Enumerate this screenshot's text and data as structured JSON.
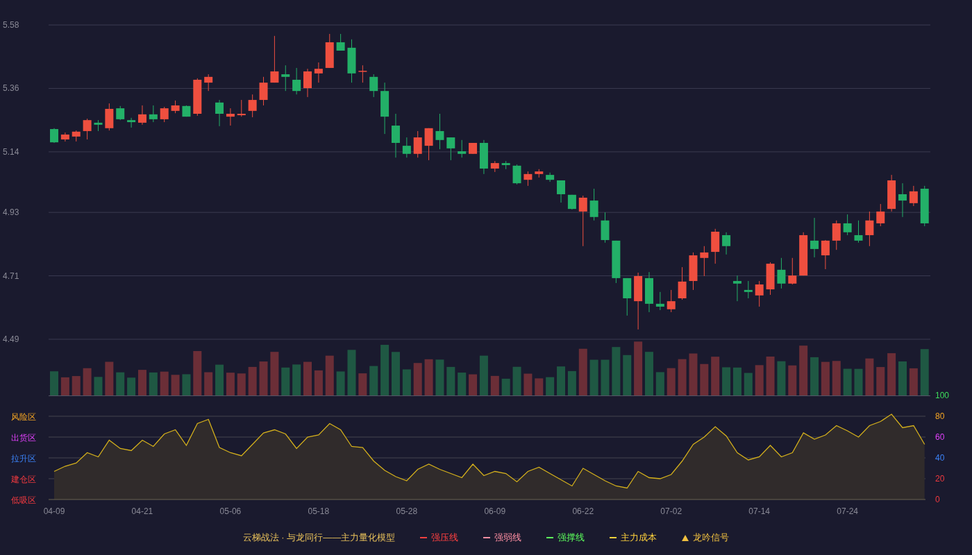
{
  "price_chart": {
    "chart_data": {
      "type": "candlestick",
      "grid": true,
      "ylim": [
        4.49,
        5.58
      ],
      "yticks": [
        {
          "value": 5.58,
          "label": "5.58"
        },
        {
          "value": 5.36,
          "label": "5.36"
        },
        {
          "value": 5.14,
          "label": "5.14"
        },
        {
          "value": 4.93,
          "label": "4.93"
        },
        {
          "value": 4.71,
          "label": "4.71"
        },
        {
          "value": 4.49,
          "label": "4.49"
        }
      ],
      "categories": [
        null,
        null,
        null,
        null,
        null,
        null,
        null,
        null,
        null,
        null,
        null,
        null,
        null,
        null,
        null,
        null,
        null,
        null,
        null,
        null,
        null,
        null,
        null,
        null,
        null,
        null,
        null,
        null,
        null,
        null,
        null,
        null,
        null,
        null,
        null,
        null,
        null,
        null,
        null,
        null,
        null,
        null,
        null,
        null,
        null,
        null,
        null,
        null,
        null,
        null,
        null,
        null,
        null,
        null,
        null,
        null,
        null,
        null,
        null,
        null,
        null,
        null,
        null,
        null,
        null,
        null,
        null,
        null,
        null,
        null,
        null,
        null,
        null,
        null,
        null,
        null,
        null,
        null,
        null,
        null
      ],
      "ohlc": [
        [
          5.219,
          5.222,
          5.171,
          5.173
        ],
        [
          5.183,
          5.207,
          5.176,
          5.2
        ],
        [
          5.193,
          5.214,
          5.176,
          5.21
        ],
        [
          5.212,
          5.255,
          5.183,
          5.25
        ],
        [
          5.241,
          5.25,
          5.212,
          5.234
        ],
        [
          5.222,
          5.308,
          5.214,
          5.289
        ],
        [
          5.291,
          5.299,
          5.25,
          5.253
        ],
        [
          5.25,
          5.258,
          5.224,
          5.243
        ],
        [
          5.241,
          5.301,
          5.234,
          5.27
        ],
        [
          5.27,
          5.301,
          5.243,
          5.253
        ],
        [
          5.253,
          5.296,
          5.243,
          5.291
        ],
        [
          5.282,
          5.318,
          5.274,
          5.301
        ],
        [
          5.299,
          5.301,
          5.262,
          5.262
        ],
        [
          5.272,
          5.395,
          5.265,
          5.39
        ],
        [
          5.38,
          5.409,
          5.351,
          5.4
        ],
        [
          5.311,
          5.32,
          5.229,
          5.272
        ],
        [
          5.262,
          5.291,
          5.231,
          5.272
        ],
        [
          5.267,
          5.32,
          5.262,
          5.272
        ],
        [
          5.282,
          5.339,
          5.26,
          5.32
        ],
        [
          5.32,
          5.4,
          5.301,
          5.38
        ],
        [
          5.38,
          5.542,
          5.38,
          5.419
        ],
        [
          5.409,
          5.44,
          5.351,
          5.4
        ],
        [
          5.39,
          5.431,
          5.339,
          5.351
        ],
        [
          5.361,
          5.428,
          5.33,
          5.419
        ],
        [
          5.412,
          5.45,
          5.38,
          5.428
        ],
        [
          5.431,
          5.549,
          5.431,
          5.52
        ],
        [
          5.52,
          5.549,
          5.491,
          5.491
        ],
        [
          5.501,
          5.53,
          5.38,
          5.412
        ],
        [
          5.419,
          5.44,
          5.38,
          5.421
        ],
        [
          5.4,
          5.409,
          5.33,
          5.351
        ],
        [
          5.351,
          5.38,
          5.202,
          5.262
        ],
        [
          5.231,
          5.272,
          5.12,
          5.171
        ],
        [
          5.161,
          5.19,
          5.12,
          5.133
        ],
        [
          5.133,
          5.212,
          5.12,
          5.19
        ],
        [
          5.161,
          5.222,
          5.111,
          5.222
        ],
        [
          5.212,
          5.272,
          5.149,
          5.181
        ],
        [
          5.19,
          5.19,
          5.111,
          5.152
        ],
        [
          5.142,
          5.181,
          5.12,
          5.133
        ],
        [
          5.133,
          5.171,
          5.133,
          5.171
        ],
        [
          5.171,
          5.181,
          5.063,
          5.082
        ],
        [
          5.082,
          5.108,
          5.07,
          5.101
        ],
        [
          5.101,
          5.108,
          5.08,
          5.094
        ],
        [
          5.092,
          5.096,
          5.027,
          5.031
        ],
        [
          5.043,
          5.072,
          5.022,
          5.063
        ],
        [
          5.063,
          5.08,
          5.051,
          5.072
        ],
        [
          5.06,
          5.068,
          5.036,
          5.043
        ],
        [
          5.041,
          5.041,
          4.964,
          4.993
        ],
        [
          4.991,
          4.991,
          4.94,
          4.942
        ],
        [
          4.933,
          4.988,
          4.813,
          4.981
        ],
        [
          4.971,
          5.012,
          4.902,
          4.914
        ],
        [
          4.902,
          4.93,
          4.825,
          4.834
        ],
        [
          4.832,
          4.832,
          4.685,
          4.702
        ],
        [
          4.702,
          4.702,
          4.572,
          4.632
        ],
        [
          4.622,
          4.721,
          4.524,
          4.709
        ],
        [
          4.702,
          4.723,
          4.584,
          4.613
        ],
        [
          4.613,
          4.654,
          4.591,
          4.603
        ],
        [
          4.594,
          4.661,
          4.584,
          4.622
        ],
        [
          4.632,
          4.74,
          4.627,
          4.69
        ],
        [
          4.692,
          4.791,
          4.661,
          4.781
        ],
        [
          4.772,
          4.813,
          4.709,
          4.791
        ],
        [
          4.793,
          4.873,
          4.752,
          4.863
        ],
        [
          4.851,
          4.861,
          4.784,
          4.813
        ],
        [
          4.692,
          4.711,
          4.622,
          4.683
        ],
        [
          4.661,
          4.692,
          4.632,
          4.654
        ],
        [
          4.642,
          4.692,
          4.603,
          4.68
        ],
        [
          4.663,
          4.757,
          4.644,
          4.752
        ],
        [
          4.731,
          4.772,
          4.666,
          4.683
        ],
        [
          4.683,
          4.772,
          4.68,
          4.711
        ],
        [
          4.711,
          4.861,
          4.711,
          4.851
        ],
        [
          4.832,
          4.911,
          4.774,
          4.803
        ],
        [
          4.781,
          4.834,
          4.733,
          4.832
        ],
        [
          4.832,
          4.902,
          4.8,
          4.892
        ],
        [
          4.892,
          4.923,
          4.851,
          4.861
        ],
        [
          4.851,
          4.902,
          4.825,
          4.832
        ],
        [
          4.851,
          4.933,
          4.813,
          4.902
        ],
        [
          4.892,
          4.959,
          4.882,
          4.933
        ],
        [
          4.942,
          5.06,
          4.933,
          5.041
        ],
        [
          4.993,
          5.031,
          4.914,
          4.971
        ],
        [
          4.962,
          5.022,
          4.952,
          5.003
        ],
        [
          5.012,
          5.022,
          4.882,
          4.892
        ]
      ]
    }
  },
  "indicator": {
    "bands": [
      {
        "tick": "100",
        "color": "#3ddc5b"
      },
      {
        "tick": "80",
        "zone": "风险区",
        "color": "#f5a623"
      },
      {
        "tick": "60",
        "zone": "出货区",
        "color": "#e040fb"
      },
      {
        "tick": "40",
        "zone": "拉升区",
        "color": "#3b82f6"
      },
      {
        "tick": "20",
        "zone": "建仓区",
        "color": "#f0393f"
      },
      {
        "tick": "0",
        "zone": "低吸区",
        "color": "#f0393f"
      }
    ],
    "chart_data": {
      "type": "area",
      "grid": true,
      "ylim": [
        0,
        100
      ],
      "yticks": [
        100,
        80,
        60,
        40,
        20,
        0
      ],
      "categories": [
        "04-09",
        null,
        null,
        null,
        null,
        null,
        null,
        null,
        "04-21",
        null,
        null,
        null,
        null,
        null,
        null,
        null,
        "05-06",
        null,
        null,
        null,
        null,
        null,
        null,
        null,
        "05-18",
        null,
        null,
        null,
        null,
        null,
        null,
        null,
        "05-28",
        null,
        null,
        null,
        null,
        null,
        null,
        null,
        "06-09",
        null,
        null,
        null,
        null,
        null,
        null,
        null,
        "06-22",
        null,
        null,
        null,
        null,
        null,
        null,
        null,
        "07-02",
        null,
        null,
        null,
        null,
        null,
        null,
        null,
        "07-14",
        null,
        null,
        null,
        null,
        null,
        null,
        null,
        "07-24",
        null,
        null,
        null,
        null,
        null,
        null,
        null
      ],
      "series": [
        {
          "color": "#d4b01c",
          "values": [
            27,
            32,
            35,
            45,
            41,
            57,
            49,
            47,
            57,
            51,
            63,
            67,
            52,
            73,
            77,
            50,
            45,
            42,
            53,
            64,
            67,
            63,
            49,
            60,
            62,
            73,
            67,
            51,
            50,
            37,
            28,
            22,
            18,
            29,
            34,
            29,
            25,
            21,
            34,
            23,
            27,
            25,
            17,
            27,
            31,
            25,
            19,
            13,
            30,
            24,
            18,
            13,
            11,
            27,
            21,
            20,
            24,
            37,
            53,
            60,
            70,
            61,
            45,
            38,
            41,
            52,
            41,
            45,
            64,
            58,
            62,
            71,
            66,
            60,
            71,
            75,
            82,
            69,
            71,
            53
          ]
        }
      ]
    }
  },
  "legend": {
    "title": "云梯战法 · 与龙同行——主力量化模型",
    "items": [
      {
        "kind": "solid",
        "label": "强压线",
        "color": "#ff4040"
      },
      {
        "kind": "dashed",
        "label": "强弱线",
        "color": "#ff8fa3"
      },
      {
        "kind": "solid",
        "label": "强撑线",
        "color": "#5cff5c"
      },
      {
        "kind": "dashed",
        "label": "主力成本",
        "color": "#ffd23c"
      },
      {
        "kind": "triangle",
        "label": "龙吟信号",
        "color": "#f0c040"
      }
    ]
  }
}
